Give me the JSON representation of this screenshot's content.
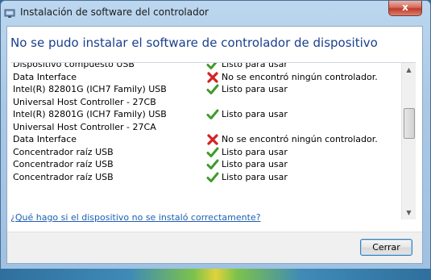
{
  "window": {
    "title": "Instalación de software del controlador",
    "close_symbol": "x"
  },
  "heading": "No se pudo instalar el software de controlador de dispositivo",
  "devices": [
    {
      "name": "Dispositivo compuesto USB",
      "status": "Listo para usar",
      "icon": "green-check-icon"
    },
    {
      "name": "Data Interface",
      "status": "No se encontró ningún controlador.",
      "icon": "red-x-icon"
    },
    {
      "name": "Intel(R) 82801G (ICH7 Family) USB Universal Host Controller - 27CB",
      "status": "Listo para usar",
      "icon": "green-check-icon"
    },
    {
      "name": "Intel(R) 82801G (ICH7 Family) USB Universal Host Controller - 27CA",
      "status": "Listo para usar",
      "icon": "green-check-icon"
    },
    {
      "name": "Data Interface",
      "status": "No se encontró ningún controlador.",
      "icon": "red-x-icon"
    },
    {
      "name": "Concentrador raíz USB",
      "status": "Listo para usar",
      "icon": "green-check-icon"
    },
    {
      "name": "Concentrador raíz USB",
      "status": "Listo para usar",
      "icon": "green-check-icon"
    },
    {
      "name": "Concentrador raíz USB",
      "status": "Listo para usar",
      "icon": "green-check-icon"
    }
  ],
  "help_link": "¿Qué hago si el dispositivo no se instaló correctamente?",
  "close_button": "Cerrar",
  "colors": {
    "heading": "#1a3f8e",
    "link": "#1d5fb3",
    "ok": "#3f9b2a",
    "error": "#d32323"
  }
}
